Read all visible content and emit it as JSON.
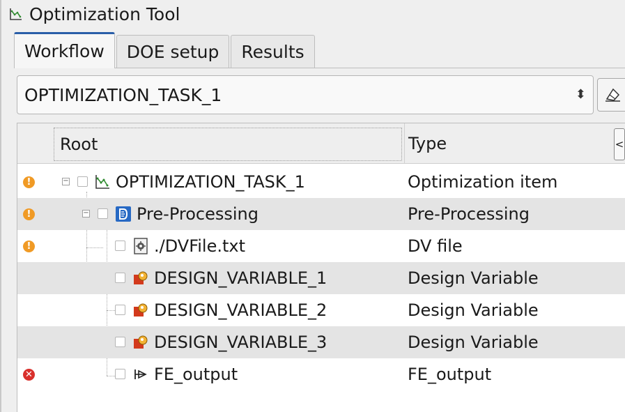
{
  "panel": {
    "title": "Optimization Tool",
    "title_icon": "optimization-chart-icon"
  },
  "tabs": [
    {
      "label": "Workflow",
      "active": true
    },
    {
      "label": "DOE setup",
      "active": false
    },
    {
      "label": "Results",
      "active": false
    }
  ],
  "task_select": {
    "value": "OPTIMIZATION_TASK_1",
    "arrow_icon": "updown-arrow-icon",
    "clear_button_icon": "eraser-icon"
  },
  "tree": {
    "columns": {
      "root": "Root",
      "type": "Type",
      "collapse": "<"
    },
    "rows": [
      {
        "status": "warning",
        "label": "OPTIMIZATION_TASK_1",
        "type": "Optimization item",
        "icon": "optimization-chart-icon"
      },
      {
        "status": "warning",
        "label": "Pre-Processing",
        "type": "Pre-Processing",
        "icon": "preprocessing-icon"
      },
      {
        "status": "warning",
        "label": "./DVFile.txt",
        "type": "DV file",
        "icon": "dv-file-icon"
      },
      {
        "status": "none",
        "label": "DESIGN_VARIABLE_1",
        "type": "Design Variable",
        "icon": "design-variable-icon"
      },
      {
        "status": "none",
        "label": "DESIGN_VARIABLE_2",
        "type": "Design Variable",
        "icon": "design-variable-icon"
      },
      {
        "status": "none",
        "label": "DESIGN_VARIABLE_3",
        "type": "Design Variable",
        "icon": "design-variable-icon"
      },
      {
        "status": "error",
        "label": "FE_output",
        "type": "FE_output",
        "icon": "output-arrow-icon"
      }
    ],
    "status_glyphs": {
      "warning": "!",
      "error": "✕"
    }
  },
  "colors": {
    "warning": "#f09a25",
    "error": "#d9302c",
    "tab_accent": "#2a5ea8",
    "preprocessing_icon": "#2769c4",
    "chart_icon": "#2f8a2f"
  }
}
